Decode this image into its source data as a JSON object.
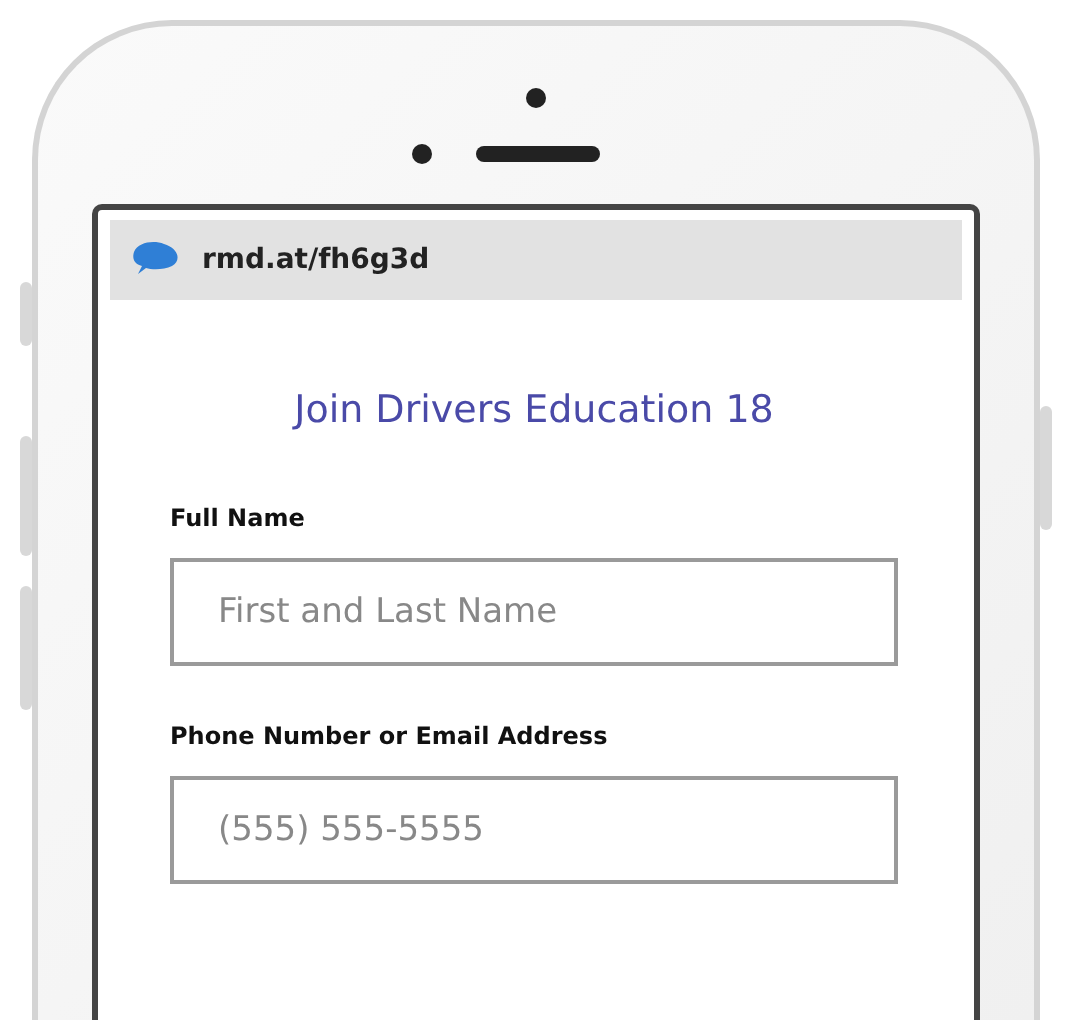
{
  "browser": {
    "url": "rmd.at/fh6g3d"
  },
  "form": {
    "title": "Join Drivers Education 18",
    "fields": [
      {
        "label": "Full Name",
        "placeholder": "First and Last Name"
      },
      {
        "label": "Phone Number or Email Address",
        "placeholder": "(555) 555-5555"
      }
    ]
  }
}
